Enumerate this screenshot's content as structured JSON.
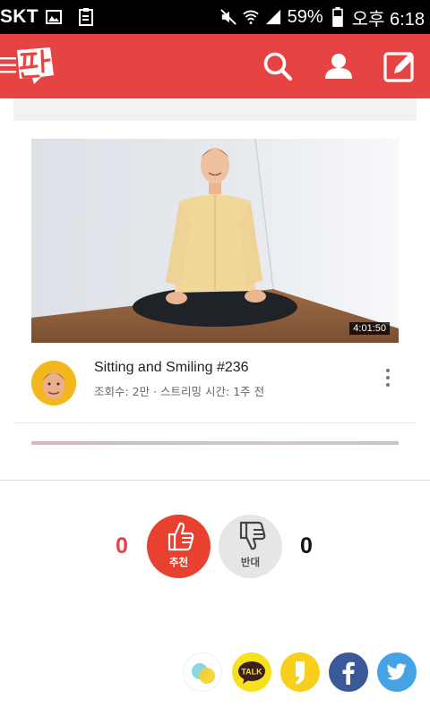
{
  "status_bar": {
    "carrier": "SKT",
    "battery": "59%",
    "time": "오후 6:18"
  },
  "video": {
    "duration": "4:01:50",
    "title": "Sitting and Smiling #236",
    "meta": "조회수: 2만 · 스트리밍 시간: 1주 전"
  },
  "votes": {
    "like_count": "0",
    "like_label": "추천",
    "dislike_count": "0",
    "dislike_label": "반대"
  },
  "share": {
    "kakaotalk_label": "TALK"
  },
  "colors": {
    "brand_red": "#e64444",
    "like_red": "#e8412f",
    "facebook_blue": "#3b5998",
    "twitter_blue": "#45a3e5",
    "kakao_yellow": "#f7e01c"
  },
  "icons": [
    "image-icon",
    "clipboard-icon",
    "mute-icon",
    "wifi-icon",
    "signal-icon",
    "battery-icon",
    "menu-icon",
    "search-icon",
    "profile-icon",
    "compose-icon",
    "more-vert-icon",
    "thumbs-up-icon",
    "thumbs-down-icon",
    "kakaostory-icon",
    "kakaotalk-icon",
    "facebook-icon",
    "twitter-icon"
  ]
}
